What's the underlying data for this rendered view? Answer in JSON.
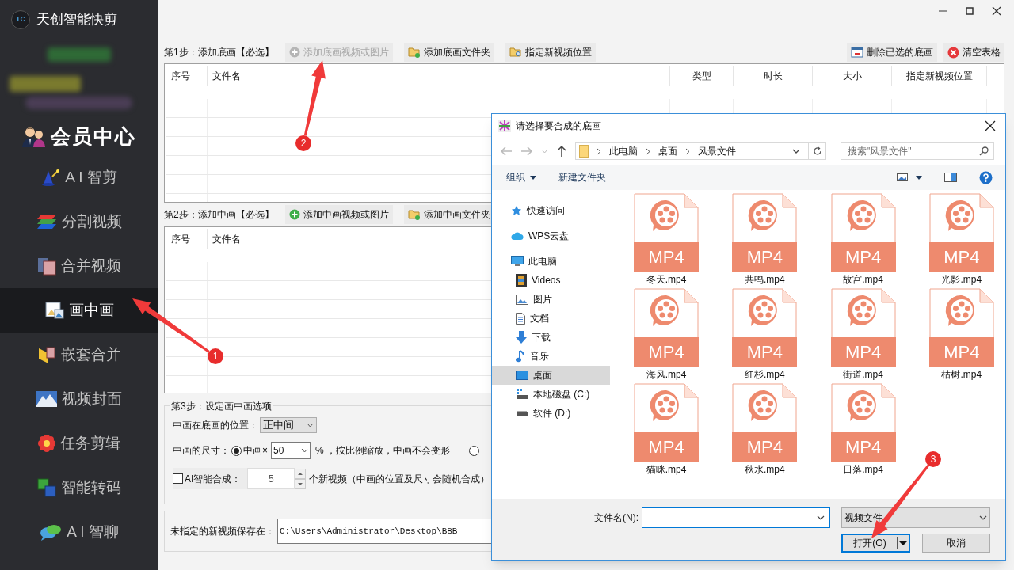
{
  "app": {
    "title": "天创智能快剪",
    "logo": "TC"
  },
  "sidebar": {
    "items": [
      {
        "label": "会员中心",
        "kind": "member",
        "selected": false
      },
      {
        "label": "A I 智剪",
        "kind": "wand",
        "selected": false
      },
      {
        "label": "分割视频",
        "kind": "split",
        "selected": false
      },
      {
        "label": "合并视频",
        "kind": "merge",
        "selected": false
      },
      {
        "label": "画中画",
        "kind": "pip",
        "selected": true
      },
      {
        "label": "嵌套合并",
        "kind": "nest",
        "selected": false
      },
      {
        "label": "视频封面",
        "kind": "cover",
        "selected": false
      },
      {
        "label": "任务剪辑",
        "kind": "flower",
        "selected": false
      },
      {
        "label": "智能转码",
        "kind": "convert",
        "selected": false
      },
      {
        "label": "A I 智聊",
        "kind": "chat",
        "selected": false
      }
    ]
  },
  "step1": {
    "label": "第1步：添加底画【必选】",
    "buttons": [
      {
        "label": "添加底画视频或图片",
        "kind": "add",
        "disabled": true
      },
      {
        "label": "添加底画文件夹",
        "kind": "folder",
        "disabled": false
      },
      {
        "label": "指定新视频位置",
        "kind": "locate",
        "disabled": false
      }
    ],
    "right_buttons": [
      {
        "label": "删除已选的底画",
        "kind": "delete"
      },
      {
        "label": "清空表格",
        "kind": "clear"
      }
    ],
    "table": {
      "columns": [
        "序号",
        "文件名",
        "类型",
        "时长",
        "大小",
        "指定新视频位置"
      ]
    }
  },
  "step2": {
    "label": "第2步：添加中画【必选】",
    "buttons": [
      {
        "label": "添加中画视频或图片",
        "kind": "add",
        "disabled": false
      },
      {
        "label": "添加中画文件夹",
        "kind": "folder",
        "disabled": false
      }
    ],
    "table": {
      "columns": [
        "序号",
        "文件名"
      ]
    }
  },
  "step3": {
    "title": "第3步：设定画中画选项",
    "position_label": "中画在底画的位置：",
    "position_value": "正中间",
    "size_label": "中画的尺寸：",
    "size_option": {
      "label": "中画×",
      "selected": true
    },
    "size_value": "50",
    "size_note": "% ，按比例缩放，中画不会变形",
    "other_option": {
      "selected": false
    },
    "ai": {
      "label": "AI智能合成：",
      "checked": false,
      "count": "5",
      "note": "个新视频（中画的位置及尺寸会随机合成）"
    }
  },
  "save": {
    "label": "未指定的新视频保存在：",
    "value": "C:\\Users\\Administrator\\Desktop\\BBB"
  },
  "dialog": {
    "title": "请选择要合成的底画",
    "path": [
      "此电脑",
      "桌面",
      "风景文件"
    ],
    "search_placeholder": "搜索\"风景文件\"",
    "toolbar": {
      "organize": "组织",
      "new_folder": "新建文件夹"
    },
    "nav": [
      {
        "label": "快速访问",
        "kind": "star",
        "selected": false
      },
      {
        "label": "WPS云盘",
        "kind": "cloud",
        "selected": false
      },
      {
        "label": "此电脑",
        "kind": "computer",
        "selected": false,
        "children": [
          {
            "label": "Videos",
            "kind": "video",
            "selected": false
          },
          {
            "label": "图片",
            "kind": "picture",
            "selected": false
          },
          {
            "label": "文档",
            "kind": "document",
            "selected": false
          },
          {
            "label": "下载",
            "kind": "download",
            "selected": false
          },
          {
            "label": "音乐",
            "kind": "music",
            "selected": false
          },
          {
            "label": "桌面",
            "kind": "desktop",
            "selected": true
          },
          {
            "label": "本地磁盘 (C:)",
            "kind": "system-drive",
            "selected": false
          },
          {
            "label": "软件 (D:)",
            "kind": "drive",
            "selected": false
          }
        ]
      }
    ],
    "files": [
      {
        "name": "冬天.mp4",
        "type": "MP4"
      },
      {
        "name": "共鸣.mp4",
        "type": "MP4"
      },
      {
        "name": "故宫.mp4",
        "type": "MP4"
      },
      {
        "name": "光影.mp4",
        "type": "MP4"
      },
      {
        "name": "海风.mp4",
        "type": "MP4"
      },
      {
        "name": "红杉.mp4",
        "type": "MP4"
      },
      {
        "name": "街道.mp4",
        "type": "MP4"
      },
      {
        "name": "枯树.mp4",
        "type": "MP4"
      },
      {
        "name": "猫咪.mp4",
        "type": "MP4"
      },
      {
        "name": "秋水.mp4",
        "type": "MP4"
      },
      {
        "name": "日落.mp4",
        "type": "MP4"
      }
    ],
    "filename_label": "文件名(N):",
    "filetype": "视频文件",
    "open_button": "打开(O)",
    "cancel_button": "取消"
  },
  "annotations": [
    {
      "number": "1"
    },
    {
      "number": "2"
    },
    {
      "number": "3"
    }
  ]
}
